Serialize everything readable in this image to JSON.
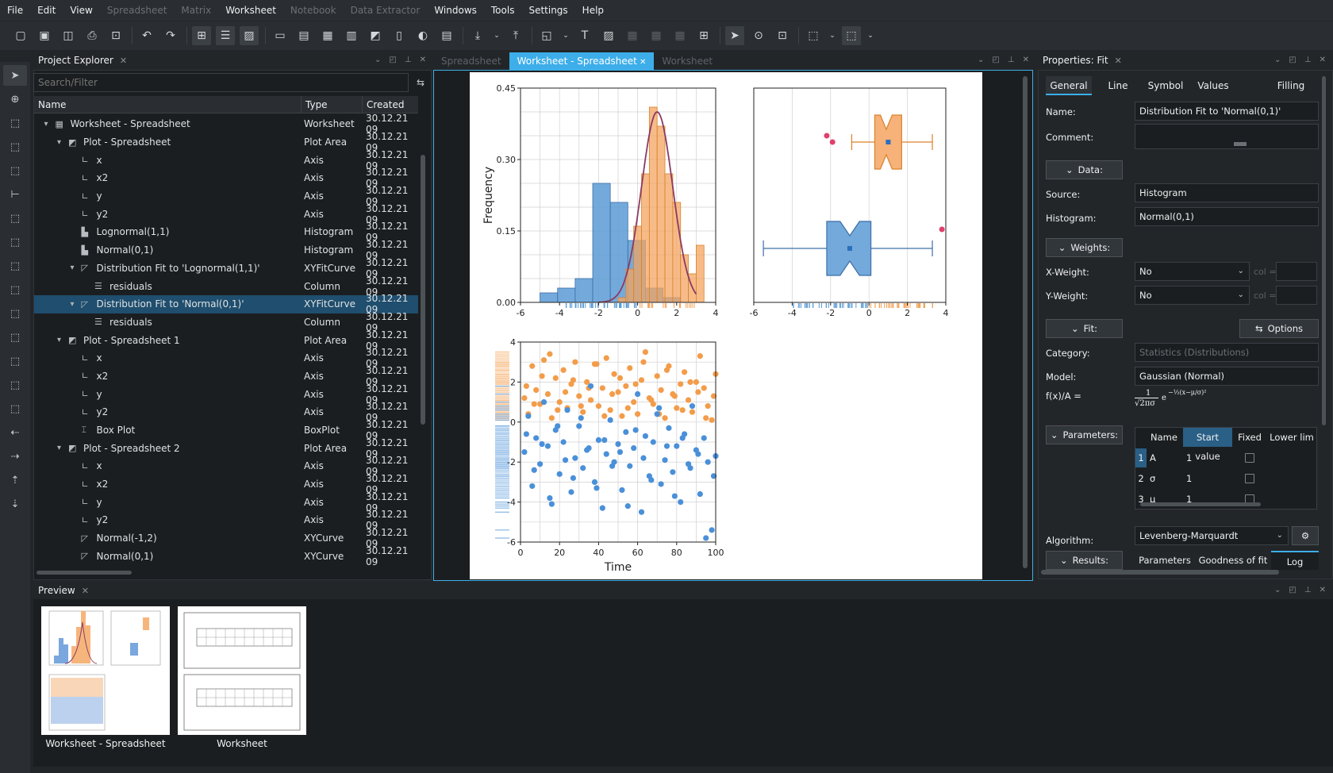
{
  "menu": [
    "File",
    "Edit",
    "View",
    "Spreadsheet",
    "Matrix",
    "Worksheet",
    "Notebook",
    "Data Extractor",
    "Windows",
    "Tools",
    "Settings",
    "Help"
  ],
  "menu_disabled": [
    false,
    false,
    false,
    true,
    true,
    false,
    true,
    true,
    false,
    false,
    false,
    false
  ],
  "project_explorer": {
    "title": "Project Explorer",
    "search_placeholder": "Search/Filter",
    "columns": [
      "Name",
      "Type",
      "Created"
    ],
    "rows": [
      {
        "depth": 1,
        "arrow": "▾",
        "icon": "worksheet",
        "name": "Worksheet - Spreadsheet",
        "type": "Worksheet",
        "created": "30.12.21 09"
      },
      {
        "depth": 2,
        "arrow": "▾",
        "icon": "plot-area",
        "name": "Plot - Spreadsheet",
        "type": "Plot Area",
        "created": "30.12.21 09"
      },
      {
        "depth": 3,
        "arrow": "",
        "icon": "axis",
        "name": "x",
        "type": "Axis",
        "created": "30.12.21 09"
      },
      {
        "depth": 3,
        "arrow": "",
        "icon": "axis",
        "name": "x2",
        "type": "Axis",
        "created": "30.12.21 09"
      },
      {
        "depth": 3,
        "arrow": "",
        "icon": "axis",
        "name": "y",
        "type": "Axis",
        "created": "30.12.21 09"
      },
      {
        "depth": 3,
        "arrow": "",
        "icon": "axis",
        "name": "y2",
        "type": "Axis",
        "created": "30.12.21 09"
      },
      {
        "depth": 3,
        "arrow": "",
        "icon": "histogram",
        "name": "Lognormal(1,1)",
        "type": "Histogram",
        "created": "30.12.21 09"
      },
      {
        "depth": 3,
        "arrow": "",
        "icon": "histogram",
        "name": "Normal(0,1)",
        "type": "Histogram",
        "created": "30.12.21 09"
      },
      {
        "depth": 3,
        "arrow": "▾",
        "icon": "fit-curve",
        "name": "Distribution Fit to 'Lognormal(1,1)'",
        "type": "XYFitCurve",
        "created": "30.12.21 09"
      },
      {
        "depth": 4,
        "arrow": "",
        "icon": "column",
        "name": "residuals",
        "type": "Column",
        "created": "30.12.21 09"
      },
      {
        "depth": 3,
        "arrow": "▾",
        "icon": "fit-curve",
        "name": "Distribution Fit to 'Normal(0,1)'",
        "type": "XYFitCurve",
        "created": "30.12.21 09",
        "selected": true
      },
      {
        "depth": 4,
        "arrow": "",
        "icon": "column",
        "name": "residuals",
        "type": "Column",
        "created": "30.12.21 09"
      },
      {
        "depth": 2,
        "arrow": "▾",
        "icon": "plot-area",
        "name": "Plot - Spreadsheet 1",
        "type": "Plot Area",
        "created": "30.12.21 09"
      },
      {
        "depth": 3,
        "arrow": "",
        "icon": "axis",
        "name": "x",
        "type": "Axis",
        "created": "30.12.21 09"
      },
      {
        "depth": 3,
        "arrow": "",
        "icon": "axis",
        "name": "x2",
        "type": "Axis",
        "created": "30.12.21 09"
      },
      {
        "depth": 3,
        "arrow": "",
        "icon": "axis",
        "name": "y",
        "type": "Axis",
        "created": "30.12.21 09"
      },
      {
        "depth": 3,
        "arrow": "",
        "icon": "axis",
        "name": "y2",
        "type": "Axis",
        "created": "30.12.21 09"
      },
      {
        "depth": 3,
        "arrow": "",
        "icon": "boxplot",
        "name": "Box Plot",
        "type": "BoxPlot",
        "created": "30.12.21 09"
      },
      {
        "depth": 2,
        "arrow": "▾",
        "icon": "plot-area",
        "name": "Plot - Spreadsheet 2",
        "type": "Plot Area",
        "created": "30.12.21 09"
      },
      {
        "depth": 3,
        "arrow": "",
        "icon": "axis",
        "name": "x",
        "type": "Axis",
        "created": "30.12.21 09"
      },
      {
        "depth": 3,
        "arrow": "",
        "icon": "axis",
        "name": "x2",
        "type": "Axis",
        "created": "30.12.21 09"
      },
      {
        "depth": 3,
        "arrow": "",
        "icon": "axis",
        "name": "y",
        "type": "Axis",
        "created": "30.12.21 09"
      },
      {
        "depth": 3,
        "arrow": "",
        "icon": "axis",
        "name": "y2",
        "type": "Axis",
        "created": "30.12.21 09"
      },
      {
        "depth": 3,
        "arrow": "",
        "icon": "xy-curve",
        "name": "Normal(-1,2)",
        "type": "XYCurve",
        "created": "30.12.21 09"
      },
      {
        "depth": 3,
        "arrow": "",
        "icon": "xy-curve",
        "name": "Normal(0,1)",
        "type": "XYCurve",
        "created": "30.12.21 09"
      }
    ]
  },
  "worksheet_tabs": [
    {
      "label": "Spreadsheet",
      "active": false
    },
    {
      "label": "Worksheet - Spreadsheet",
      "active": true
    },
    {
      "label": "Worksheet",
      "active": false
    }
  ],
  "properties": {
    "title": "Properties: Fit",
    "tabs": [
      "General",
      "Line",
      "Symbol",
      "Values",
      "Filling"
    ],
    "active_tab": "General",
    "name_label": "Name:",
    "name_value": "Distribution Fit to 'Normal(0,1)'",
    "comment_label": "Comment:",
    "data_section": "Data:",
    "source_label": "Source:",
    "source_value": "Histogram",
    "histogram_label": "Histogram:",
    "histogram_value": "Normal(0,1)",
    "weights_section": "Weights:",
    "xweight_label": "X-Weight:",
    "xweight_value": "No",
    "yweight_label": "Y-Weight:",
    "yweight_value": "No",
    "col_hint": "col =",
    "fit_section": "Fit:",
    "options_button": "Options",
    "category_label": "Category:",
    "category_value": "Statistics (Distributions)",
    "model_label": "Model:",
    "model_value": "Gaussian (Normal)",
    "formula_label": "f(x)/A =",
    "parameters_section": "Parameters:",
    "param_columns": [
      "Name",
      "Start value",
      "Fixed",
      "Lower lim"
    ],
    "params": [
      {
        "index": "1",
        "name": "A",
        "start": "1"
      },
      {
        "index": "2",
        "name": "σ",
        "start": "1"
      },
      {
        "index": "3",
        "name": "μ",
        "start": "1"
      }
    ],
    "algorithm_label": "Algorithm:",
    "algorithm_value": "Levenberg-Marquardt",
    "results_section": "Results:",
    "result_tabs": [
      "Parameters",
      "Goodness of fit",
      "Log"
    ]
  },
  "preview": {
    "title": "Preview",
    "items": [
      "Worksheet - Spreadsheet",
      "Worksheet"
    ]
  },
  "chart_data": [
    {
      "type": "bar",
      "ylabel": "Frequency",
      "xlim": [
        -6,
        4
      ],
      "ylim": [
        0,
        0.45
      ],
      "xticks": [
        "-6",
        "-4",
        "-2",
        "0",
        "2",
        "4"
      ],
      "yticks": [
        "0.00",
        "0.15",
        "0.30",
        "0.45"
      ],
      "series": [
        {
          "bin_start": -5.0,
          "bin_width": 0.9,
          "values": [
            0.02,
            0.03,
            0.05,
            0.25,
            0.21,
            0.13,
            0.03,
            0.01,
            0.0,
            0.0
          ],
          "color": "#5b9bd5"
        },
        {
          "bin_start": -1.0,
          "bin_width": 0.4,
          "values": [
            0.01,
            0.07,
            0.16,
            0.27,
            0.41,
            0.37,
            0.27,
            0.21,
            0.1,
            0.06,
            0.12
          ],
          "color": "#f4a460"
        }
      ],
      "fit_curve": {
        "model": "gaussian",
        "mu": 1.0,
        "sigma": 0.8,
        "peak": 0.4,
        "color": "#8b3a62"
      },
      "rug": true
    },
    {
      "type": "boxplot",
      "xlim": [
        -6,
        4
      ],
      "xticks": [
        "-6",
        "-4",
        "-2",
        "0",
        "2",
        "4"
      ],
      "boxes": [
        {
          "name": "orange",
          "whisker_low": -0.9,
          "q1": 0.3,
          "median": 0.9,
          "q3": 1.7,
          "whisker_high": 3.3,
          "mean": 1.0,
          "outliers": [
            -2.2,
            -1.9
          ],
          "color": "#f4a460"
        },
        {
          "name": "blue",
          "whisker_low": -5.5,
          "q1": -2.2,
          "median": -1.0,
          "q3": 0.1,
          "whisker_high": 3.3,
          "mean": -1.0,
          "outliers": [
            3.8
          ],
          "color": "#5b9bd5"
        }
      ]
    },
    {
      "type": "scatter",
      "xlabel": "Time",
      "xlim": [
        0,
        100
      ],
      "ylim": [
        -6,
        4
      ],
      "xticks": [
        "0",
        "20",
        "40",
        "60",
        "80",
        "100"
      ],
      "yticks": [
        "-6",
        "-4",
        "-2",
        "0",
        "2",
        "4"
      ],
      "series": [
        {
          "name": "orange",
          "color": "#f39c4a",
          "x": [
            2,
            4,
            6,
            8,
            10,
            12,
            14,
            16,
            18,
            20,
            22,
            24,
            26,
            28,
            30,
            32,
            34,
            36,
            38,
            40,
            42,
            44,
            46,
            48,
            50,
            52,
            54,
            56,
            58,
            60,
            62,
            64,
            66,
            68,
            70,
            72,
            74,
            76,
            78,
            80,
            82,
            84,
            86,
            88,
            90,
            92,
            94,
            96,
            98,
            100,
            3,
            7,
            11,
            15,
            19,
            23,
            27,
            31,
            35,
            39,
            43,
            47,
            51,
            55,
            59,
            63,
            67,
            71,
            75,
            79,
            83,
            87,
            91,
            95,
            99
          ],
          "y": [
            1.2,
            0.4,
            2.8,
            1.6,
            0.9,
            3.1,
            1.4,
            0.2,
            2.2,
            1.0,
            2.6,
            0.7,
            1.9,
            3.0,
            1.3,
            0.5,
            2.0,
            1.1,
            2.9,
            0.8,
            1.7,
            3.2,
            0.6,
            2.4,
            1.5,
            0.3,
            1.8,
            2.7,
            1.0,
            0.4,
            2.1,
            3.5,
            1.2,
            0.9,
            2.3,
            1.6,
            0.2,
            2.8,
            1.4,
            0.7,
            1.9,
            2.5,
            1.1,
            0.5,
            2.0,
            3.3,
            1.7,
            0.8,
            0.1,
            2.4,
            1.8,
            0.9,
            2.3,
            3.4,
            0.6,
            1.5,
            2.1,
            0.8,
            1.7,
            2.9,
            0.3,
            1.4,
            2.2,
            0.7,
            1.9,
            3.0,
            1.1,
            0.4,
            2.6,
            1.3,
            0.6,
            2.0,
            1.5,
            0.2,
            1.3
          ]
        },
        {
          "name": "blue",
          "color": "#4a90d9",
          "x": [
            2,
            4,
            6,
            8,
            10,
            12,
            14,
            16,
            18,
            20,
            22,
            24,
            26,
            28,
            30,
            32,
            34,
            36,
            38,
            40,
            42,
            44,
            46,
            48,
            50,
            52,
            54,
            56,
            58,
            60,
            62,
            64,
            66,
            68,
            70,
            72,
            74,
            76,
            78,
            80,
            82,
            84,
            86,
            88,
            90,
            92,
            94,
            96,
            98,
            100,
            3,
            7,
            11,
            15,
            19,
            23,
            27,
            31,
            35,
            39,
            43,
            47,
            51,
            55,
            59,
            63,
            67,
            71,
            75,
            79,
            83,
            87,
            91,
            95,
            99
          ],
          "y": [
            -1.5,
            0.3,
            -3.2,
            -0.8,
            -2.1,
            1.0,
            -1.2,
            -4.1,
            -0.4,
            -2.6,
            -1.0,
            0.6,
            -3.5,
            -1.8,
            -0.2,
            -2.3,
            -1.4,
            1.8,
            -3.0,
            -0.9,
            -4.3,
            -1.6,
            0.1,
            -2.0,
            -1.1,
            -3.4,
            -0.5,
            -2.2,
            -1.3,
            1.4,
            -4.5,
            -0.7,
            -2.7,
            -1.0,
            0.4,
            -3.1,
            -1.9,
            -0.3,
            -2.5,
            -1.2,
            -4.0,
            -0.6,
            -2.1,
            0.8,
            -1.4,
            -3.6,
            -0.8,
            -2.0,
            -5.4,
            -1.7,
            -0.6,
            -2.4,
            -1.1,
            -3.8,
            -0.2,
            -1.9,
            -2.8,
            0.2,
            -1.3,
            -3.3,
            -0.9,
            -2.2,
            -1.5,
            -4.2,
            -0.4,
            -1.8,
            -2.9,
            0.7,
            -1.2,
            -3.7,
            -0.8,
            -2.3,
            -1.6,
            -5.8,
            -2.7
          ]
        }
      ],
      "rug": true
    }
  ],
  "colors": {
    "accent": "#3daee9",
    "orange": "#f4a460",
    "blue": "#5b9bd5",
    "fit": "#8b3a62",
    "bg": "#232629"
  }
}
